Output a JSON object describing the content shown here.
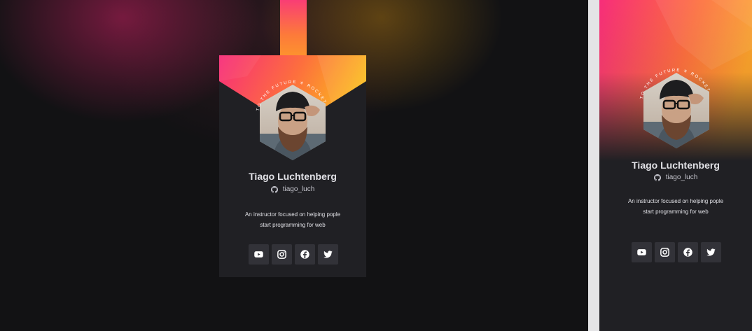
{
  "profile": {
    "name": "Tiago Luchtenberg",
    "github_user": "tiago_luch",
    "bio_line1": "An instructor focused on helping pople",
    "bio_line2": "start programming for web",
    "ring_text": "TO THE FUTURE ✳ ROCKET"
  },
  "socials": [
    {
      "label": "YouTube",
      "icon": "youtube-icon"
    },
    {
      "label": "Instagram",
      "icon": "instagram-icon"
    },
    {
      "label": "Facebook",
      "icon": "facebook-icon"
    },
    {
      "label": "Twitter",
      "icon": "twitter-icon"
    }
  ],
  "colors": {
    "page_bg": "#121214",
    "card_bg": "#202024",
    "button_bg": "#323238",
    "gradient_pink": "#f72d7a",
    "gradient_orange": "#fd7a3a",
    "gradient_yellow": "#fbb81e",
    "text": "#e1e1e6"
  }
}
